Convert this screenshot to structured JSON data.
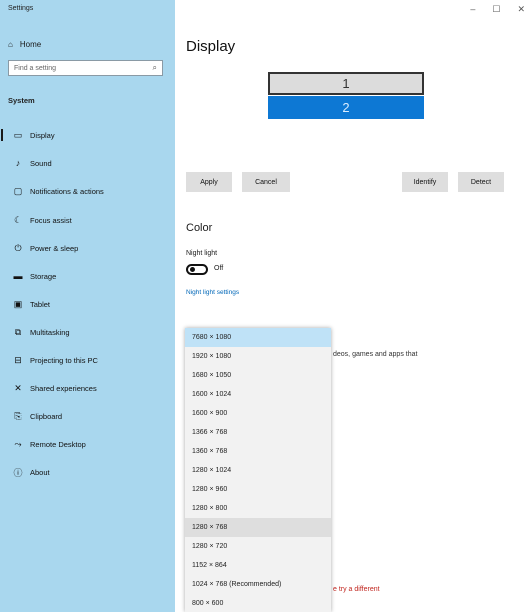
{
  "window": {
    "title": "Settings",
    "controls": [
      "–",
      "☐",
      "✕"
    ]
  },
  "sidebar": {
    "home": "Home",
    "search_placeholder": "Find a setting",
    "section": "System",
    "items": [
      {
        "label": "Display",
        "icon": "monitor-icon"
      },
      {
        "label": "Sound",
        "icon": "speaker-icon"
      },
      {
        "label": "Notifications & actions",
        "icon": "notifications-icon"
      },
      {
        "label": "Focus assist",
        "icon": "moon-icon"
      },
      {
        "label": "Power & sleep",
        "icon": "power-icon"
      },
      {
        "label": "Storage",
        "icon": "storage-icon"
      },
      {
        "label": "Tablet",
        "icon": "tablet-icon"
      },
      {
        "label": "Multitasking",
        "icon": "multitasking-icon"
      },
      {
        "label": "Projecting to this PC",
        "icon": "projecting-icon"
      },
      {
        "label": "Shared experiences",
        "icon": "shared-icon"
      },
      {
        "label": "Clipboard",
        "icon": "clipboard-icon"
      },
      {
        "label": "Remote Desktop",
        "icon": "remote-desktop-icon"
      },
      {
        "label": "About",
        "icon": "info-icon"
      }
    ]
  },
  "main": {
    "title": "Display",
    "monitors": [
      "1",
      "2"
    ],
    "buttons": {
      "apply": "Apply",
      "cancel": "Cancel",
      "identify": "Identify",
      "detect": "Detect"
    },
    "color_heading": "Color",
    "night_light_label": "Night light",
    "night_light_state": "Off",
    "night_light_link": "Night light settings",
    "hidden_text_1": "deos, games and apps that",
    "hidden_text_2": "e try a different"
  },
  "resolution_dropdown": {
    "selected": "7680 × 1080",
    "options": [
      "7680 × 1080",
      "1920 × 1080",
      "1680 × 1050",
      "1600 × 1024",
      "1600 × 900",
      "1366 × 768",
      "1360 × 768",
      "1280 × 1024",
      "1280 × 960",
      "1280 × 800",
      "1280 × 768",
      "1280 × 720",
      "1152 × 864",
      "1024 × 768 (Recommended)",
      "800 × 600"
    ]
  }
}
